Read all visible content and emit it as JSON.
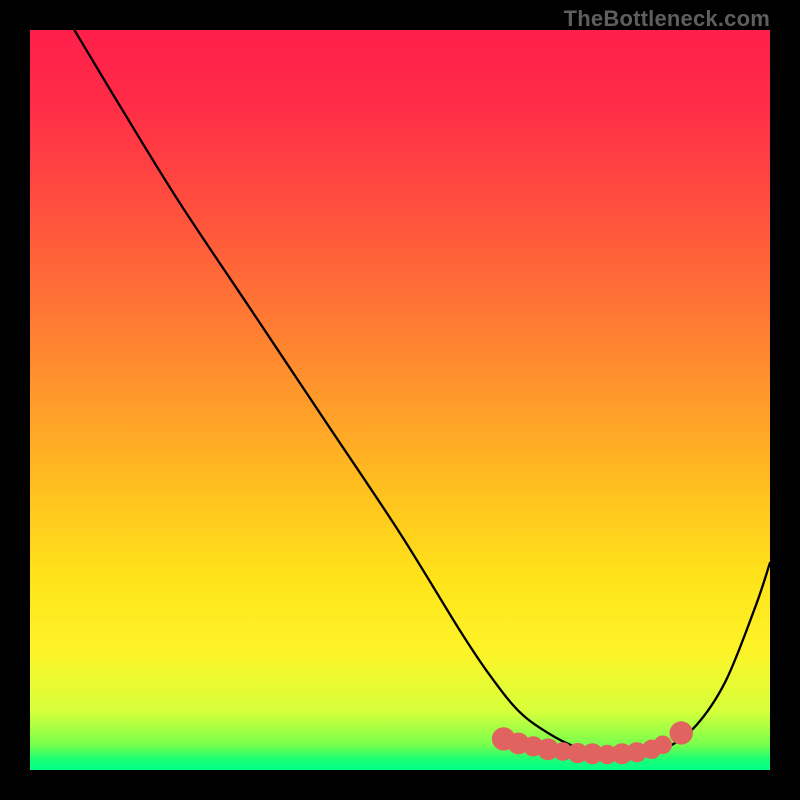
{
  "attribution": "TheBottleneck.com",
  "gradient": {
    "stops": [
      {
        "offset": 0.0,
        "color": "#ff1f4a"
      },
      {
        "offset": 0.1,
        "color": "#ff2c47"
      },
      {
        "offset": 0.22,
        "color": "#ff4a3f"
      },
      {
        "offset": 0.35,
        "color": "#ff6e36"
      },
      {
        "offset": 0.5,
        "color": "#ff9a2a"
      },
      {
        "offset": 0.62,
        "color": "#ffc01f"
      },
      {
        "offset": 0.74,
        "color": "#ffe31a"
      },
      {
        "offset": 0.84,
        "color": "#fdf428"
      },
      {
        "offset": 0.92,
        "color": "#d7ff3a"
      },
      {
        "offset": 0.965,
        "color": "#7aff4c"
      },
      {
        "offset": 0.985,
        "color": "#1dff73"
      },
      {
        "offset": 1.0,
        "color": "#00ff88"
      }
    ]
  },
  "chart_data": {
    "type": "line",
    "title": "",
    "xlabel": "",
    "ylabel": "",
    "xlim": [
      0,
      100
    ],
    "ylim": [
      0,
      100
    ],
    "series": [
      {
        "name": "curve",
        "x": [
          6,
          12,
          20,
          30,
          40,
          50,
          58,
          62,
          66,
          70,
          74,
          78,
          82,
          86,
          90,
          94,
          98,
          100
        ],
        "y": [
          100,
          90,
          77,
          62,
          47,
          32,
          19,
          13,
          8,
          5,
          3,
          2,
          2,
          3,
          6,
          12,
          22,
          28
        ]
      }
    ],
    "markers": {
      "name": "bottom-markers",
      "color": "#e0635f",
      "points": [
        {
          "x": 64,
          "y": 4.2,
          "r": 1.9
        },
        {
          "x": 66,
          "y": 3.6,
          "r": 1.7
        },
        {
          "x": 68,
          "y": 3.2,
          "r": 1.5
        },
        {
          "x": 70,
          "y": 2.8,
          "r": 1.7
        },
        {
          "x": 72,
          "y": 2.5,
          "r": 1.3
        },
        {
          "x": 74,
          "y": 2.3,
          "r": 1.5
        },
        {
          "x": 76,
          "y": 2.2,
          "r": 1.6
        },
        {
          "x": 78,
          "y": 2.1,
          "r": 1.4
        },
        {
          "x": 80,
          "y": 2.2,
          "r": 1.6
        },
        {
          "x": 82,
          "y": 2.4,
          "r": 1.5
        },
        {
          "x": 84,
          "y": 2.8,
          "r": 1.4
        },
        {
          "x": 85.5,
          "y": 3.4,
          "r": 1.3
        },
        {
          "x": 88,
          "y": 5.0,
          "r": 1.9
        }
      ]
    }
  }
}
